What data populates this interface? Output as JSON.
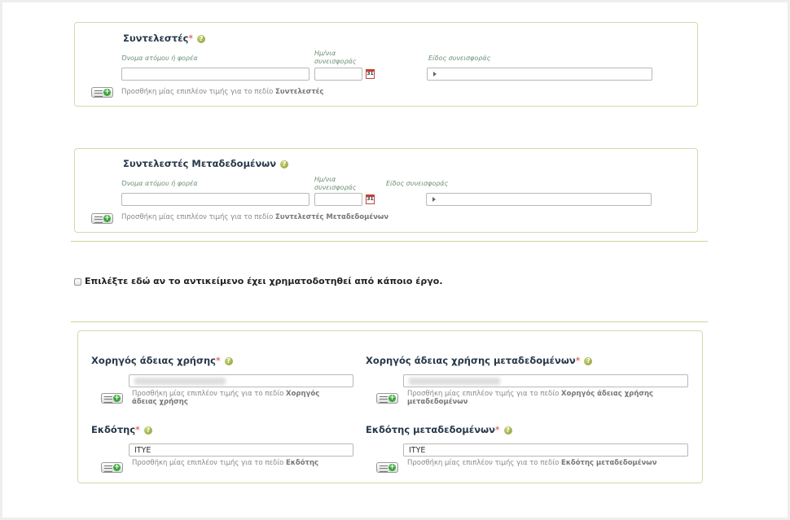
{
  "contributors": {
    "title": "Συντελεστές",
    "required_mark": "*",
    "label_name": "Όνομα ατόμου ή φορέα",
    "label_date": "Ημ/νια συνεισφοράς",
    "label_type": "Είδος συνεισφοράς",
    "calendar_day": "31",
    "add_text_prefix": "Προσθήκη μίας επιπλέον τιμής για το πεδίο",
    "add_text_field": "Συντελεστές"
  },
  "metadata_contributors": {
    "title": "Συντελεστές Μεταδεδομένων",
    "label_name": "Όνομα ατόμου ή φορέα",
    "label_date": "Ημ/νια συνεισφοράς",
    "label_type": "Είδος συνεισφοράς",
    "calendar_day": "31",
    "add_text_prefix": "Προσθήκη μίας επιπλέον τιμής για το πεδίο",
    "add_text_field": "Συντελεστές Μεταδεδομένων"
  },
  "funding_checkbox": {
    "label": "Επιλέξτε εδώ αν το αντικείμενο έχει χρηματοδοτηθεί από κάποιο έργο.",
    "checked": false
  },
  "license": {
    "required_mark": "*",
    "grantor": {
      "title": "Χορηγός άδειας χρήσης",
      "add_text_prefix": "Προσθήκη μίας επιπλέον τιμής για το πεδίο",
      "add_text_field": "Χορηγός άδειας χρήσης"
    },
    "metadata_grantor": {
      "title": "Χορηγός άδειας χρήσης μεταδεδομένων",
      "add_text_prefix": "Προσθήκη μίας επιπλέον τιμής για το πεδίο",
      "add_text_field": "Χορηγός άδειας χρήσης μεταδεδομένων"
    },
    "publisher": {
      "title": "Εκδότης",
      "value": "ΙΤΥΕ",
      "add_text_prefix": "Προσθήκη μίας επιπλέον τιμής για το πεδίο",
      "add_text_field": "Εκδότης"
    },
    "metadata_publisher": {
      "title": "Εκδότης μεταδεδομένων",
      "value": "ΙΤΥΕ",
      "add_text_prefix": "Προσθήκη μίας επιπλέον τιμής για το πεδίο",
      "add_text_field": "Εκδότης μεταδεδομένων"
    }
  },
  "icons": {
    "help": "help-icon",
    "calendar": "calendar-icon",
    "add": "add-value-icon"
  },
  "colors": {
    "panel_border": "#cfdcaa",
    "title": "#27384a",
    "label": "#6b8e74",
    "required": "#d9463c",
    "add_green": "#3da63a"
  }
}
